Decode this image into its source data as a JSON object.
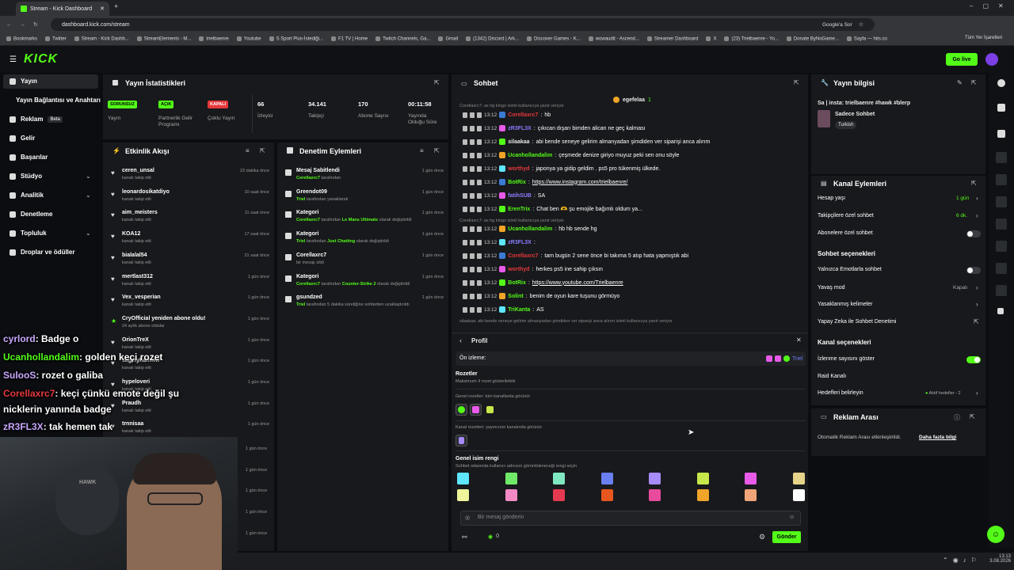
{
  "browser": {
    "tab_title": "Stream - Kick Dashboard",
    "url": "dashboard.kick.com/stream",
    "google_btn": "Google'a Sor",
    "bookmarks": [
      "Bookmarks",
      "Twitter",
      "Stream - Kick Dashb...",
      "StreamElements - M...",
      "trielbaenre",
      "Youtube",
      "S Sport Plus-İstediği...",
      "F1 TV | Home",
      "Twitch Channels, Ga...",
      "Gmail",
      "(1342) Discord | Ark...",
      "Discover Games - K...",
      "wowaudit - Ascend...",
      "Streamer Dashboard",
      "X",
      "(23) Trielbaenre - Yo...",
      "Donate ByNoGame...",
      "Sayfa — hits.co"
    ],
    "all_bookmarks": "Tüm Yer İşaretleri"
  },
  "header": {
    "logo": "KICK",
    "go_live": "Go live"
  },
  "sidebar": {
    "items": [
      {
        "label": "Yayın"
      },
      {
        "label": "Yayın Bağlantısı ve Anahtarı"
      },
      {
        "label": "Reklam",
        "badge": "Beta"
      },
      {
        "label": "Gelir"
      },
      {
        "label": "Başarılar"
      },
      {
        "label": "Stüdyo"
      },
      {
        "label": "Analitik"
      },
      {
        "label": "Denetleme"
      },
      {
        "label": "Topluluk"
      },
      {
        "label": "Droplar ve ödüller"
      }
    ]
  },
  "stats": {
    "title": "Yayın İstatistikleri",
    "status": [
      {
        "badge": "SORUNSUZ",
        "label": "Yayın",
        "color": "#53fc18"
      },
      {
        "badge": "AÇIK",
        "label": "Partnerlik Gelir Programı",
        "color": "#53fc18"
      },
      {
        "badge": "KAPALI",
        "label": "Çoklu Yayın",
        "color": "#e5383b"
      }
    ],
    "numbers": [
      {
        "value": "66",
        "label": "İzleyici"
      },
      {
        "value": "34.141",
        "label": "Takipçi"
      },
      {
        "value": "170",
        "label": "Abone Sayısı"
      },
      {
        "value": "00:11:58",
        "label": "Yayında Olduğu Süre"
      }
    ]
  },
  "activity": {
    "title": "Etkinlik Akışı",
    "items": [
      {
        "name": "ceren_unsal",
        "sub": "kanalı takip etti",
        "time": "23 dakika önce"
      },
      {
        "name": "leonardosikatdiyo",
        "sub": "kanalı takip etti",
        "time": "10 saat önce"
      },
      {
        "name": "aim_meisters",
        "sub": "kanalı takip etti",
        "time": "11 saat önce"
      },
      {
        "name": "KOA12",
        "sub": "kanalı takip etti",
        "time": "17 saat önce"
      },
      {
        "name": "bialalal54",
        "sub": "kanalı takip etti",
        "time": "21 saat önce"
      },
      {
        "name": "mertlast312",
        "sub": "kanalı takip etti",
        "time": "1 gün önce"
      },
      {
        "name": "Vex_vesperian",
        "sub": "kanalı takip etti",
        "time": "1 gün önce"
      },
      {
        "name": "CryOfficial yeniden abone oldu!",
        "sub": "24 aylık abone oldular",
        "time": "1 gün önce"
      },
      {
        "name": "OrionTreX",
        "sub": "kanalı takip etti",
        "time": "1 gün önce"
      },
      {
        "name": "sagmyhamww",
        "sub": "kanalı takip etti",
        "time": "1 gün önce"
      },
      {
        "name": "hypeloveri",
        "sub": "kanalı takip etti",
        "time": "1 gün önce"
      },
      {
        "name": "Praudh",
        "sub": "kanalı takip etti",
        "time": "1 gün önce"
      },
      {
        "name": "trnnisaa",
        "sub": "kanalı takip etti",
        "time": "1 gün önce"
      }
    ],
    "extra_times": [
      "1 gün önce",
      "1 gün önce",
      "1 gün önce",
      "1 gün önce",
      "1 gün önce",
      "1 gün önce"
    ]
  },
  "moderation": {
    "title": "Denetim Eylemleri",
    "items": [
      {
        "name": "Mesaj Sabitlendi",
        "user": "Corellaxrc7",
        "sub": " tarafından",
        "hl": "",
        "end": "",
        "time": "1 gün önce"
      },
      {
        "name": "Greendot09",
        "user": "Triel",
        "sub": " tarafından yasaklandı",
        "hl": "",
        "end": "",
        "time": "1 gün önce"
      },
      {
        "name": "Kategori",
        "user": "Corellaxrc7",
        "sub": " tarafından ",
        "hl": "Le Mans Ultimate",
        "end": " olarak değiştirildi",
        "time": "1 gün önce"
      },
      {
        "name": "Kategori",
        "user": "Triel",
        "sub": " tarafından ",
        "hl": "Just Chatting",
        "end": " olarak değiştirildi",
        "time": "1 gün önce"
      },
      {
        "name": "Corellaxrc7",
        "user": "",
        "sub": "bir mesajı sildi",
        "hl": "",
        "end": "",
        "time": "1 gün önce"
      },
      {
        "name": "Kategori",
        "user": "Corellaxrc7",
        "sub": " tarafından ",
        "hl": "Counter-Strike 2",
        "end": " olarak değiştirildi",
        "time": "1 gün önce"
      },
      {
        "name": "gsundzed",
        "user": "Triel",
        "sub": " tarafından 5 dakika süreliğine sohbetten uzaklaştırıldı",
        "hl": "",
        "end": "",
        "time": "1 gün önce"
      }
    ]
  },
  "chat": {
    "title": "Sohbet",
    "pinned_user": "egefelaa",
    "pinned_count": "1",
    "reply_top": "Corellaxrc7: as hg kingo isimli kullanıcıya yanıt veriyor",
    "messages": [
      {
        "time": "13:12",
        "user": "Corellaxrc7",
        "color": "#e5383b",
        "text": "hb"
      },
      {
        "time": "13:12",
        "user": "zR3FL3X",
        "color": "#8a7dff",
        "text": "çıkıcan dışarı bimden alican ne geç kalması"
      },
      {
        "time": "13:12",
        "user": "silaakaa",
        "color": "#e8e8e8",
        "text": "abi bende seneye gelirim almanyadan şimdiden ver siparişi anca alırım"
      },
      {
        "time": "13:12",
        "user": "Ucanhollandalim",
        "color": "#53fc18",
        "text": "çeşmede denize giriyo muyuz peki sen onu söyle"
      },
      {
        "time": "13:12",
        "user": "worthyd",
        "color": "#e5383b",
        "text": "japonya ya gidip geldim . ps5 pro tükenmiş ülkede."
      },
      {
        "time": "13:12",
        "user": "BotRix",
        "color": "#53fc18",
        "text": "https://www.instagram.com/trielbaenre/"
      },
      {
        "time": "13:12",
        "user": "fatihSUB",
        "color": "#8a7dff",
        "text": "SA"
      },
      {
        "time": "13:12",
        "user": "ErenTrix",
        "color": "#53fc18",
        "text": "Chat ben 🫶 şu emojile bağımlı oldum ya..."
      },
      {
        "time": "13:12",
        "user": "Ucanhollandalim",
        "color": "#53fc18",
        "text": "hb hb sende hg"
      },
      {
        "time": "13:12",
        "user": "zR3FL3X",
        "color": "#8a7dff",
        "text": ""
      },
      {
        "time": "13:12",
        "user": "Corellaxrc7",
        "color": "#e5383b",
        "text": "tam bugün 2 sene önce bi takıma 5 atıp hata yapmıştık abi"
      },
      {
        "time": "13:12",
        "user": "worthyd",
        "color": "#e5383b",
        "text": "herkes ps5 ine sahip çıksın"
      },
      {
        "time": "13:12",
        "user": "BotRix",
        "color": "#53fc18",
        "text": "https://www.youtube.com/Trielbaenre"
      },
      {
        "time": "13:12",
        "user": "Solint",
        "color": "#53fc18",
        "text": "benim de oyun kare tuşunu görmüyo"
      },
      {
        "time": "13:12",
        "user": "TriKanta",
        "color": "#53fc18",
        "text": "AS"
      }
    ],
    "reply_mid": "Corellaxrc7: as hg kingo isimli kullanıcıya yanıt veriyor",
    "reply_bottom": "silaakaa: abi bende seneye gelirim almanyadan şimdiden ver siparişi anca alırım isimli kullanıcıya yanıt veriyor",
    "input_placeholder": "Bir mesaj gönderin",
    "send": "Gönder",
    "points": "0"
  },
  "profile": {
    "title": "Profil",
    "preview_label": "Ön izleme:",
    "preview_name": "Triel",
    "badges_title": "Rozetler",
    "badges_sub": "Maksimum 4 rozet gösterilebilir",
    "global_badges": "Genel rozetler: tüm kanallarda görünür",
    "channel_badges": "Kanal rozetleri: yayıncının kanalında görünür",
    "name_color_title": "Genel isim rengi",
    "name_color_sub": "Sohbet odasında kullanıcı adınızın görüntüleneceği rengi seçin",
    "swatches": [
      "#5ee6ff",
      "#70e86a",
      "#7fe8c0",
      "#6a7ff0",
      "#a78bfa",
      "#c7e84a",
      "#e85ae8",
      "#e6d48a",
      "#eef59a",
      "#f38ac6",
      "#e53950",
      "#e8561f",
      "#e84a9e",
      "#f0a428",
      "#f0a478",
      "#ffffff"
    ]
  },
  "stream_info": {
    "title": "Yayın bilgisi",
    "stream_title": "Sa | insta: trielbaenre #hawk #blerp",
    "category": "Sadece Sohbet",
    "tag": "Turkish"
  },
  "channel_actions": {
    "title": "Kanal Eylemleri",
    "rows": [
      {
        "label": "Hesap yaşı",
        "value": "1 gün"
      },
      {
        "label": "Takipçilere özel sohbet",
        "value": "6 dk."
      },
      {
        "label": "Abonelere özel sohbet",
        "value": ""
      }
    ],
    "chat_section": "Sohbet seçenekleri",
    "chat_rows": [
      {
        "label": "Yalnızca Emotlarla sohbet"
      },
      {
        "label": "Yavaş mod",
        "value": "Kapalı"
      },
      {
        "label": "Yasaklanmış kelimeler"
      },
      {
        "label": "Yapay Zeka ile Sohbet Denetimi"
      }
    ],
    "channel_section": "Kanal seçenekleri",
    "channel_rows": [
      {
        "label": "İzlenme sayısını göster"
      },
      {
        "label": "Raid Kanalı"
      },
      {
        "label": "Hedefleri belirleyin",
        "value": "Aktif hedefler - 2"
      }
    ]
  },
  "ad_break": {
    "title": "Reklam Arası",
    "text": "Otomatik Reklam Arası etkinleştirildi.",
    "link": "Daha fazla bilgi"
  },
  "overlay": {
    "lines": [
      {
        "user": "cyrlord",
        "color": "#c9a8ff",
        "text": ": Badge o"
      },
      {
        "user": "Ucanhollandalim",
        "color": "#53fc18",
        "text": ": golden keçi rozet"
      },
      {
        "user": "SulooS",
        "color": "#c9a8ff",
        "text": ": rozet o galiba"
      },
      {
        "user": "Corellaxrc7",
        "color": "#e5383b",
        "text": ": keçi çünkü emote değil şu"
      },
      {
        "user": "",
        "color": "#ffffff",
        "text": "nicklerin yanında badge"
      },
      {
        "user": "zR3FL3X",
        "color": "#c9a8ff",
        "text": ": tak hemen tak"
      }
    ]
  },
  "taskbar": {
    "time": "13:13",
    "date": "3.08.2026"
  }
}
